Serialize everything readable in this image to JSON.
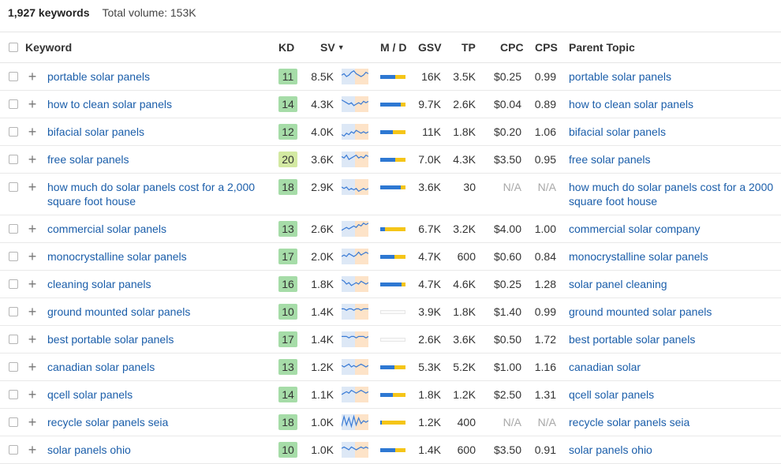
{
  "summary": {
    "count": "1,927 keywords",
    "volume": "Total volume: 153K"
  },
  "columns": {
    "keyword": "Keyword",
    "kd": "KD",
    "sv": "SV",
    "md": "M / D",
    "gsv": "GSV",
    "tp": "TP",
    "cpc": "CPC",
    "cps": "CPS",
    "parent": "Parent Topic"
  },
  "colors": {
    "link": "#1b5eaa",
    "kd_easy": "#a6dca8",
    "kd_medium": "#d3e9a2",
    "clicks_bar": "#2e78d2",
    "no_clicks_bar": "#f5c518"
  },
  "rows": [
    {
      "keyword": [
        "portable solar panels"
      ],
      "kd": "11",
      "sv": "8.5K",
      "gsv": "16K",
      "tp": "3.5K",
      "cpc": "$0.25",
      "cps": "0.99",
      "parent": [
        "portable solar panels"
      ],
      "md_clicks": 0.6,
      "md_empty": false,
      "trend": [
        6,
        7,
        5,
        6,
        8,
        9,
        7,
        6,
        5,
        6,
        8,
        7
      ]
    },
    {
      "keyword": [
        "how to clean solar panels"
      ],
      "kd": "14",
      "sv": "4.3K",
      "gsv": "9.7K",
      "tp": "2.6K",
      "cpc": "$0.04",
      "cps": "0.89",
      "parent": [
        "how to clean solar panels"
      ],
      "md_clicks": 0.82,
      "md_empty": false,
      "trend": [
        8,
        7,
        6,
        5,
        6,
        4,
        5,
        6,
        5,
        7,
        6,
        7
      ]
    },
    {
      "keyword": [
        "bifacial solar panels"
      ],
      "kd": "12",
      "sv": "4.0K",
      "gsv": "11K",
      "tp": "1.8K",
      "cpc": "$0.20",
      "cps": "1.06",
      "parent": [
        "bifacial solar panels"
      ],
      "md_clicks": 0.5,
      "md_empty": false,
      "trend": [
        3,
        2,
        4,
        3,
        5,
        4,
        6,
        5,
        4,
        5,
        4,
        5
      ]
    },
    {
      "keyword": [
        "free solar panels"
      ],
      "kd": "20",
      "sv": "3.6K",
      "gsv": "7.0K",
      "tp": "4.3K",
      "cpc": "$3.50",
      "cps": "0.95",
      "parent": [
        "free solar panels"
      ],
      "md_clicks": 0.6,
      "md_empty": false,
      "trend": [
        7,
        6,
        8,
        5,
        6,
        7,
        8,
        6,
        7,
        6,
        8,
        7
      ]
    },
    {
      "keyword": [
        "how much do solar panels cost for a 2,000",
        "square foot house"
      ],
      "kd": "18",
      "sv": "2.9K",
      "gsv": "3.6K",
      "tp": "30",
      "cpc": "N/A",
      "cps": "N/A",
      "parent": [
        "how much do solar panels cost for a 2000",
        "square foot house"
      ],
      "md_clicks": 0.82,
      "md_empty": false,
      "trend": [
        5,
        4,
        5,
        3,
        4,
        3,
        4,
        2,
        3,
        4,
        3,
        4
      ]
    },
    {
      "keyword": [
        "commercial solar panels"
      ],
      "kd": "13",
      "sv": "2.6K",
      "gsv": "6.7K",
      "tp": "3.2K",
      "cpc": "$4.00",
      "cps": "1.00",
      "parent": [
        "commercial solar company"
      ],
      "md_clicks": 0.2,
      "md_empty": false,
      "trend": [
        4,
        5,
        6,
        5,
        6,
        7,
        6,
        8,
        7,
        9,
        8,
        9
      ]
    },
    {
      "keyword": [
        "monocrystalline solar panels"
      ],
      "kd": "17",
      "sv": "2.0K",
      "gsv": "4.7K",
      "tp": "600",
      "cpc": "$0.60",
      "cps": "0.84",
      "parent": [
        "monocrystalline solar panels"
      ],
      "md_clicks": 0.55,
      "md_empty": false,
      "trend": [
        5,
        6,
        5,
        7,
        6,
        5,
        6,
        8,
        6,
        7,
        8,
        7
      ]
    },
    {
      "keyword": [
        "cleaning solar panels"
      ],
      "kd": "16",
      "sv": "1.8K",
      "gsv": "4.7K",
      "tp": "4.6K",
      "cpc": "$0.25",
      "cps": "1.28",
      "parent": [
        "solar panel cleaning"
      ],
      "md_clicks": 0.85,
      "md_empty": false,
      "trend": [
        8,
        7,
        5,
        6,
        4,
        5,
        6,
        5,
        7,
        6,
        5,
        6
      ]
    },
    {
      "keyword": [
        "ground mounted solar panels"
      ],
      "kd": "10",
      "sv": "1.4K",
      "gsv": "3.9K",
      "tp": "1.8K",
      "cpc": "$1.40",
      "cps": "0.99",
      "parent": [
        "ground mounted solar panels"
      ],
      "md_clicks": 0,
      "md_empty": true,
      "trend": [
        7,
        7,
        6,
        7,
        7,
        6,
        7,
        7,
        6,
        7,
        7,
        7
      ]
    },
    {
      "keyword": [
        "best portable solar panels"
      ],
      "kd": "17",
      "sv": "1.4K",
      "gsv": "2.6K",
      "tp": "3.6K",
      "cpc": "$0.50",
      "cps": "1.72",
      "parent": [
        "best portable solar panels"
      ],
      "md_clicks": 0,
      "md_empty": true,
      "trend": [
        7,
        7,
        7,
        6,
        7,
        7,
        6,
        7,
        7,
        7,
        6,
        7
      ]
    },
    {
      "keyword": [
        "canadian solar panels"
      ],
      "kd": "13",
      "sv": "1.2K",
      "gsv": "5.3K",
      "tp": "5.2K",
      "cpc": "$1.00",
      "cps": "1.16",
      "parent": [
        "canadian solar"
      ],
      "md_clicks": 0.55,
      "md_empty": false,
      "trend": [
        6,
        5,
        6,
        7,
        5,
        6,
        5,
        6,
        7,
        6,
        5,
        6
      ]
    },
    {
      "keyword": [
        "qcell solar panels"
      ],
      "kd": "14",
      "sv": "1.1K",
      "gsv": "1.8K",
      "tp": "1.2K",
      "cpc": "$2.50",
      "cps": "1.31",
      "parent": [
        "qcell solar panels"
      ],
      "md_clicks": 0.5,
      "md_empty": false,
      "trend": [
        5,
        6,
        7,
        6,
        8,
        7,
        6,
        7,
        8,
        7,
        6,
        7
      ]
    },
    {
      "keyword": [
        "recycle solar panels seia"
      ],
      "kd": "18",
      "sv": "1.0K",
      "gsv": "1.2K",
      "tp": "400",
      "cpc": "N/A",
      "cps": "N/A",
      "parent": [
        "recycle solar panels seia"
      ],
      "md_clicks": 0.05,
      "md_empty": false,
      "trend": [
        2,
        9,
        3,
        8,
        2,
        9,
        3,
        8,
        4,
        6,
        5,
        6
      ]
    },
    {
      "keyword": [
        "solar panels ohio"
      ],
      "kd": "10",
      "sv": "1.0K",
      "gsv": "1.4K",
      "tp": "600",
      "cpc": "$3.50",
      "cps": "0.91",
      "parent": [
        "solar panels ohio"
      ],
      "md_clicks": 0.6,
      "md_empty": false,
      "trend": [
        6,
        7,
        6,
        5,
        7,
        6,
        5,
        6,
        7,
        6,
        7,
        6
      ]
    }
  ]
}
